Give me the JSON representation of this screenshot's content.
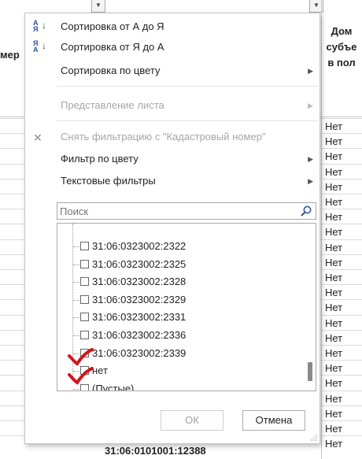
{
  "sheet": {
    "left_header": "мер",
    "right_header_lines": [
      "Дом",
      "субъе",
      "в пол"
    ],
    "net_values": [
      "Нет",
      "Нет",
      "Нет",
      "Нет",
      "Нет",
      "Нет",
      "Нет",
      "Нет",
      "Нет",
      "Нет",
      "Нет",
      "Нет",
      "Нет",
      "Нет",
      "Нет",
      "Нет",
      "Нет",
      "Нет",
      "Нет",
      "Нет",
      "Нет",
      "Нет"
    ],
    "bottom_cell": "31:06:0101001:12388"
  },
  "menu": {
    "sort_az": "Сортировка от А до Я",
    "sort_za": "Сортировка от Я до А",
    "sort_color": "Сортировка по цвету",
    "sheet_view": "Представление листа",
    "clear_filter": "Снять фильтрацию с \"Кадастровый номер\"",
    "filter_color": "Фильтр по цвету",
    "text_filters": "Текстовые фильтры"
  },
  "search": {
    "placeholder": "Поиск"
  },
  "list": {
    "items": [
      "31:06:0323002:2322",
      "31:06:0323002:2325",
      "31:06:0323002:2328",
      "31:06:0323002:2329",
      "31:06:0323002:2331",
      "31:06:0323002:2336",
      "31:06:0323002:2339",
      "нет",
      "(Пустые)"
    ]
  },
  "buttons": {
    "ok": "ОК",
    "cancel": "Отмена"
  },
  "colors": {
    "accent": "#2b579a",
    "check_annotation": "#d0161b",
    "disabled": "#a6a6a6"
  }
}
